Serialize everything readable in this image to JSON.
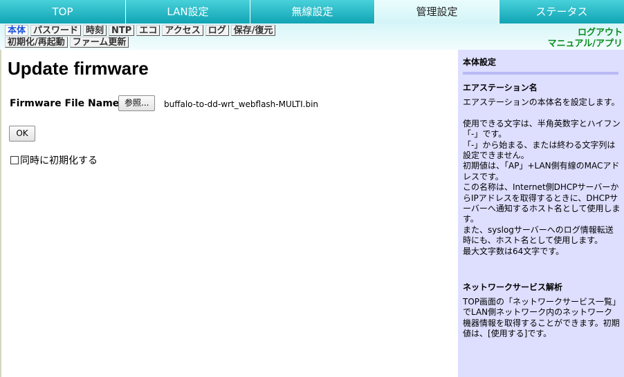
{
  "tabs": [
    {
      "label": "TOP"
    },
    {
      "label": "LAN設定"
    },
    {
      "label": "無線設定"
    },
    {
      "label": "管理設定",
      "active": true
    },
    {
      "label": "ステータス"
    }
  ],
  "submenu": {
    "row1": [
      "本体",
      "パスワード",
      "時刻",
      "NTP",
      "エコ",
      "アクセス",
      "ログ",
      "保存/復元"
    ],
    "row2": [
      "初期化/再起動",
      "ファーム更新"
    ],
    "active": "本体"
  },
  "links": {
    "logout": "ログアウト",
    "manual": "マニュアル/アプリ"
  },
  "main": {
    "title": "Update firmware",
    "firmware_label": "Firmware File Name",
    "browse_label": "参照...",
    "file_name": "buffalo-to-dd-wrt_webflash-MULTI.bin",
    "ok_label": "OK",
    "init_label": "同時に初期化する",
    "init_checked": false
  },
  "help": {
    "heading": "本体設定",
    "section1": {
      "title": "エアステーション名",
      "paragraphs": [
        "エアステーションの本体名を設定します。",
        "",
        "使用できる文字は、半角英数字とハイフン「-」です。",
        "「-」から始まる、または終わる文字列は設定できません。",
        "初期値は、「AP」+LAN側有線のMACアドレスです。",
        "この名称は、Internet側DHCPサーバーからIPアドレスを取得するときに、DHCPサーバーへ通知するホスト名として使用します。",
        "また、syslogサーバーへのログ情報転送時にも、ホスト名として使用します。",
        "最大文字数は64文字です。"
      ]
    },
    "section2": {
      "title": "ネットワークサービス解析",
      "paragraphs": [
        "TOP画面の「ネットワークサービス一覧」でLAN側ネットワーク内のネットワーク機器情報を取得することができます。初期値は、[使用する]です。"
      ]
    }
  }
}
